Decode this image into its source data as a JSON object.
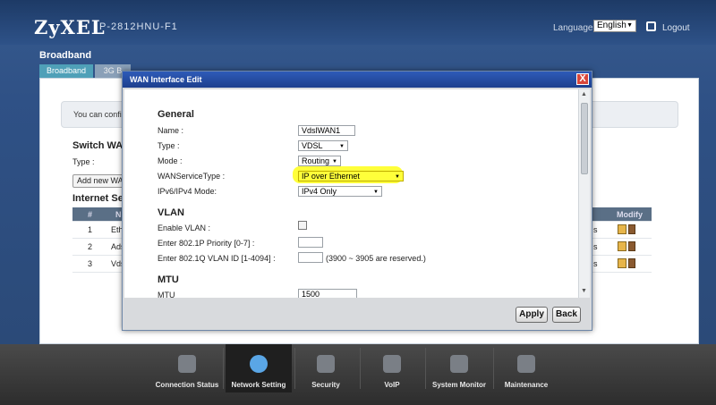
{
  "header": {
    "logo": "ZyXEL",
    "model": "P-2812HNU-F1",
    "language_label": "Language :",
    "language_value": "English",
    "logout": "Logout"
  },
  "background": {
    "title": "Broadband",
    "tabs": [
      "Broadband",
      "3G B"
    ],
    "info_text": "You can config",
    "switch_title": "Switch WAN",
    "type_label": "Type :",
    "add_button": "Add new WAN",
    "internet_title": "Internet Set",
    "table_headers": [
      "#",
      "N",
      "Modify"
    ],
    "rows": [
      {
        "num": "1",
        "name": "Eth",
        "right": "s"
      },
      {
        "num": "2",
        "name": "Ads",
        "right": "s"
      },
      {
        "num": "3",
        "name": "Vds",
        "right": "s"
      }
    ]
  },
  "dialog": {
    "title": "WAN Interface Edit",
    "close_label": "X",
    "general": {
      "title": "General",
      "name_label": "Name :",
      "name_value": "VdslWAN1",
      "type_label": "Type :",
      "type_value": "VDSL",
      "mode_label": "Mode :",
      "mode_value": "Routing",
      "wan_service_label": "WANServiceType :",
      "wan_service_value": "IP over Ethernet",
      "ipmode_label": "IPv6/IPv4 Mode:",
      "ipmode_value": "IPv4 Only"
    },
    "vlan": {
      "title": "VLAN",
      "enable_label": "Enable VLAN :",
      "priority_label": "Enter 802.1P Priority [0-7] :",
      "priority_value": "",
      "vlanid_label": "Enter 802.1Q VLAN ID [1-4094] :",
      "vlanid_value": "",
      "vlanid_note": "(3900 ~ 3905 are reserved.)"
    },
    "mtu": {
      "title": "MTU",
      "mtu_label": "MTU",
      "mtu_value": "1500"
    },
    "apply": "Apply",
    "back": "Back"
  },
  "nav": [
    {
      "label": "Connection Status",
      "icon": "connection-status-icon"
    },
    {
      "label": "Network Setting",
      "icon": "network-setting-icon",
      "active": true
    },
    {
      "label": "Security",
      "icon": "security-icon"
    },
    {
      "label": "VoIP",
      "icon": "voip-icon"
    },
    {
      "label": "System Monitor",
      "icon": "system-monitor-icon"
    },
    {
      "label": "Maintenance",
      "icon": "maintenance-icon"
    }
  ],
  "colors": {
    "title_bar": "#2e5bb8",
    "highlight": "#ffff3a",
    "header": "#1d3a66"
  }
}
